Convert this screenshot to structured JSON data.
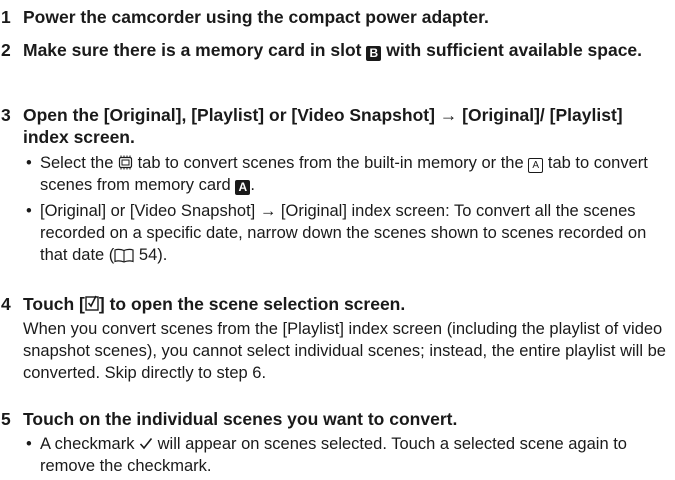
{
  "steps": [
    {
      "num": "1",
      "text": "Power the camcorder using the compact power adapter."
    },
    {
      "num": "2",
      "text_a": "Make sure there is a memory card in slot",
      "badge": "B",
      "text_b": "with sufficient available space."
    },
    {
      "num": "3",
      "text": "Open the [Original], [Playlist] or [Video Snapshot] → [Original]/ [Playlist] index screen."
    },
    {
      "num": "4",
      "text_a": "Touch [",
      "text_b": "] to open the scene selection screen."
    },
    {
      "num": "5",
      "text": "Touch on the individual scenes you want to convert."
    }
  ],
  "step3_bullets": [
    {
      "a": "Select the",
      "b": "tab to convert scenes from the built-in memory or the",
      "badge_outline": "A",
      "c": "tab to convert scenes from memory card",
      "badge_solid": "A",
      "d": "."
    },
    {
      "a": "[Original] or [Video Snapshot] → [Original] index screen: To convert all the scenes recorded on a specific date, narrow down the scenes shown to scenes recorded on that date (",
      "page": "54",
      "b": ")."
    }
  ],
  "step4_note": "When you convert scenes from the [Playlist] index screen (including the playlist of video snapshot scenes), you cannot select individual scenes; instead, the entire playlist will be converted. Skip directly to step 6.",
  "step5_bullets": [
    {
      "a": "A checkmark",
      "b": "will appear on scenes selected. Touch a selected scene again to remove the checkmark."
    }
  ],
  "bullet_char": "•",
  "icons": {
    "memory": "built-in-memory-icon",
    "book": "page-reference-icon",
    "check": "checkmark-icon",
    "select": "select-checkbox-icon"
  }
}
